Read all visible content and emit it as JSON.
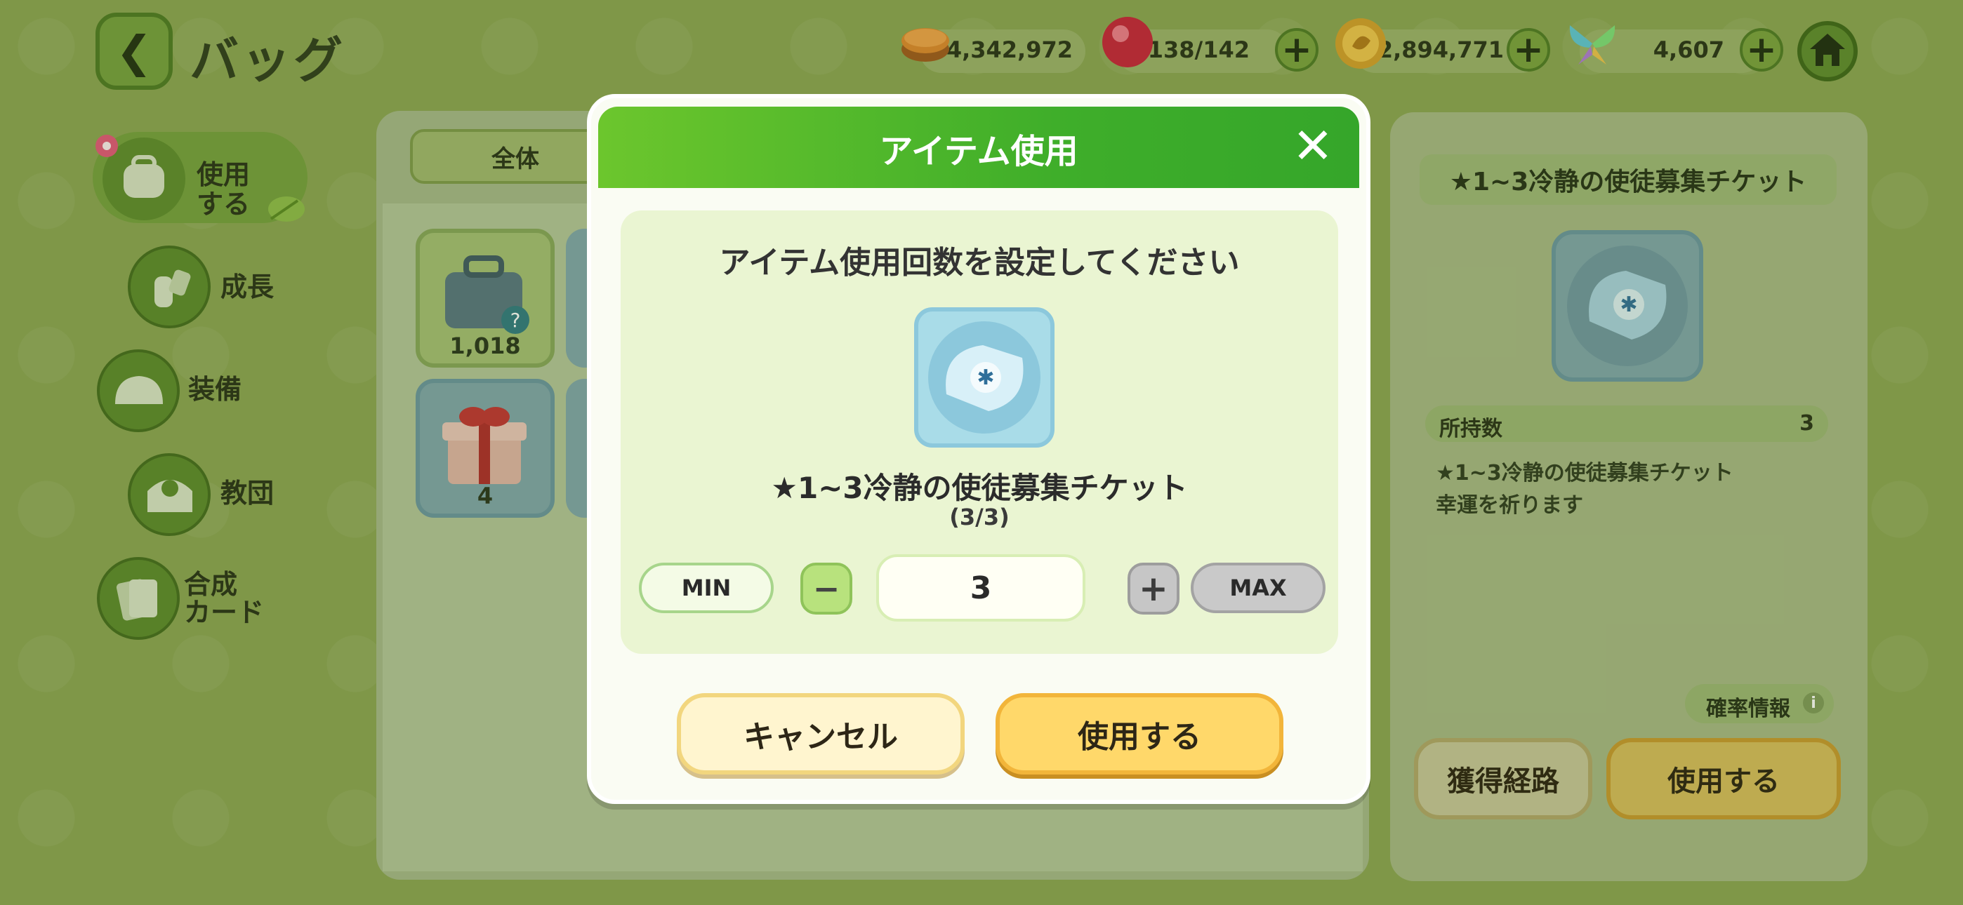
{
  "header": {
    "title": "バッグ",
    "resources": [
      {
        "icon": "cookie-currency-icon",
        "value": "4,342,972",
        "has_plus": false
      },
      {
        "icon": "red-candy-stamina-icon",
        "value": "138/142",
        "has_plus": true
      },
      {
        "icon": "gold-coin-icon",
        "value": "2,894,771",
        "has_plus": true
      },
      {
        "icon": "butterfly-crystal-icon",
        "value": "4,607",
        "has_plus": true
      }
    ]
  },
  "nav": {
    "items": [
      {
        "label_line1": "使用",
        "label_line2": "する",
        "active": true
      },
      {
        "label": "成長"
      },
      {
        "label": "装備"
      },
      {
        "label": "教団"
      },
      {
        "label_line1": "合成",
        "label_line2": "カード"
      }
    ]
  },
  "bag": {
    "tab_all": "全体",
    "slots": [
      {
        "icon": "toolbox-random-icon",
        "count": "1,018"
      },
      {
        "icon": "gift-box-icon",
        "count": "4"
      }
    ]
  },
  "detail": {
    "title": "★1~3冷静の使徒募集チケット",
    "owned_label": "所持数",
    "owned_value": "3",
    "desc_line1": "★1~3冷静の使徒募集チケット",
    "desc_line2": "幸運を祈ります",
    "prob_label": "確率情報",
    "source_button": "獲得経路",
    "use_button": "使用する"
  },
  "modal": {
    "title": "アイテム使用",
    "prompt": "アイテム使用回数を設定してください",
    "item_name": "★1~3冷静の使徒募集チケット",
    "item_count": "(3/3)",
    "min_label": "MIN",
    "max_label": "MAX",
    "quantity": "3",
    "cancel_label": "キャンセル",
    "use_label": "使用する"
  },
  "colors": {
    "background": "#8ba552",
    "modal_header": "#3fae2a",
    "use_button": "#ffd86a",
    "cancel_button": "#fff5cf"
  }
}
